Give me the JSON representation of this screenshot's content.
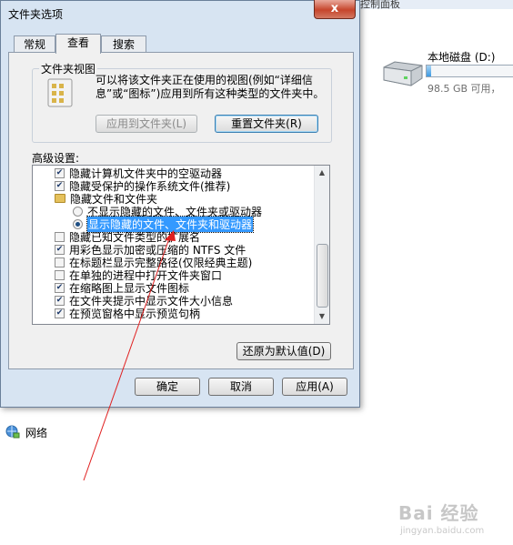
{
  "background": {
    "header_partial": "控制面板",
    "drive": {
      "name": "本地磁盘 (D:)",
      "free_text": "98.5 GB 可用，",
      "usage_fraction": 0.05
    },
    "network_label": "网络",
    "watermark": {
      "brand": "Bai 经验",
      "url": "jingyan.baidu.com"
    }
  },
  "dialog": {
    "title": "文件夹选项",
    "close_glyph": "x",
    "tabs": [
      {
        "label": "常规",
        "active": false
      },
      {
        "label": "查看",
        "active": true
      },
      {
        "label": "搜索",
        "active": false
      }
    ],
    "folder_views": {
      "group_label": "文件夹视图",
      "description": "可以将该文件夹正在使用的视图(例如“详细信息”或“图标”)应用到所有这种类型的文件夹中。",
      "apply_button": "应用到文件夹(L)",
      "reset_button": "重置文件夹(R)"
    },
    "advanced": {
      "label": "高级设置:",
      "items": [
        {
          "type": "checkbox",
          "checked": true,
          "label": "隐藏计算机文件夹中的空驱动器"
        },
        {
          "type": "checkbox",
          "checked": true,
          "label": "隐藏受保护的操作系统文件(推荐)"
        },
        {
          "type": "folder",
          "label": "隐藏文件和文件夹"
        },
        {
          "type": "radio",
          "checked": false,
          "label": "不显示隐藏的文件、文件夹或驱动器"
        },
        {
          "type": "radio",
          "checked": true,
          "selected": true,
          "label": "显示隐藏的文件、文件夹和驱动器"
        },
        {
          "type": "checkbox",
          "checked": false,
          "label": "隐藏已知文件类型的扩展名"
        },
        {
          "type": "checkbox",
          "checked": true,
          "label": "用彩色显示加密或压缩的 NTFS 文件"
        },
        {
          "type": "checkbox",
          "checked": false,
          "label": "在标题栏显示完整路径(仅限经典主题)"
        },
        {
          "type": "checkbox",
          "checked": false,
          "label": "在单独的进程中打开文件夹窗口"
        },
        {
          "type": "checkbox",
          "checked": true,
          "label": "在缩略图上显示文件图标"
        },
        {
          "type": "checkbox",
          "checked": true,
          "label": "在文件夹提示中显示文件大小信息"
        },
        {
          "type": "checkbox",
          "checked": true,
          "label": "在预览窗格中显示预览句柄"
        }
      ],
      "restore_button": "还原为默认值(D)"
    },
    "buttons": {
      "ok": "确定",
      "cancel": "取消",
      "apply": "应用(A)"
    }
  },
  "colors": {
    "selection": "#3399ff",
    "annotation": "#e02020",
    "dialog_bg": "#d7e4f2"
  }
}
